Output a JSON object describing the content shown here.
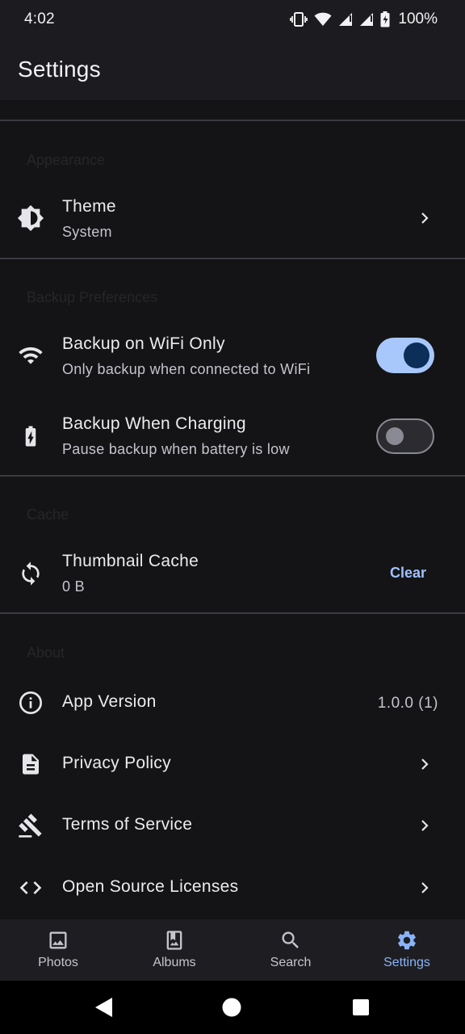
{
  "status_bar": {
    "time": "4:02",
    "battery": "100%"
  },
  "app_bar": {
    "title": "Settings"
  },
  "sections": {
    "appearance": {
      "header": "Appearance",
      "theme": {
        "title": "Theme",
        "subtitle": "System",
        "icon": "brightness-icon"
      }
    },
    "backup": {
      "header": "Backup Preferences",
      "wifi_only": {
        "title": "Backup on WiFi Only",
        "subtitle": "Only backup when connected to WiFi",
        "enabled": true,
        "icon": "wifi-icon"
      },
      "charging": {
        "title": "Backup When Charging",
        "subtitle": "Pause backup when battery is low",
        "enabled": false,
        "icon": "battery-charging-icon"
      }
    },
    "cache": {
      "header": "Cache",
      "thumbnail": {
        "title": "Thumbnail Cache",
        "subtitle": "0 B",
        "action": "Clear",
        "icon": "sync-icon"
      }
    },
    "about": {
      "header": "About",
      "version": {
        "title": "App Version",
        "value": "1.0.0 (1)",
        "icon": "info-icon"
      },
      "privacy": {
        "title": "Privacy Policy",
        "icon": "document-icon"
      },
      "terms": {
        "title": "Terms of Service",
        "icon": "gavel-icon"
      },
      "licenses": {
        "title": "Open Source Licenses",
        "icon": "code-icon"
      }
    }
  },
  "bottom_nav": {
    "items": [
      {
        "label": "Photos",
        "icon": "photo-icon",
        "active": false
      },
      {
        "label": "Albums",
        "icon": "album-icon",
        "active": false
      },
      {
        "label": "Search",
        "icon": "search-icon",
        "active": false
      },
      {
        "label": "Settings",
        "icon": "gear-icon",
        "active": true
      }
    ]
  },
  "colors": {
    "accent": "#8ab4f8",
    "switch_on_track": "#a8c7fa",
    "background": "#141416"
  }
}
